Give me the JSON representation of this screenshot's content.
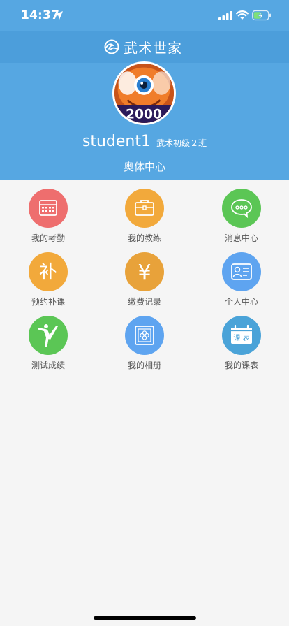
{
  "status_bar": {
    "time": "14:37"
  },
  "nav": {
    "title": "武术世家"
  },
  "profile": {
    "username": "student1",
    "class_name": "武术初级２班",
    "center_name": "奥体中心"
  },
  "menu": [
    {
      "label": "我的考勤",
      "icon": "attendance-calendar-icon",
      "color": "#ee6e6e"
    },
    {
      "label": "我的教练",
      "icon": "briefcase-icon",
      "color": "#f2a93b"
    },
    {
      "label": "消息中心",
      "icon": "chat-bubble-icon",
      "color": "#5bc655"
    },
    {
      "label": "预约补课",
      "icon": "makeup-class-icon",
      "color": "#f2a93b",
      "glyph": "补"
    },
    {
      "label": "缴费记录",
      "icon": "yen-icon",
      "color": "#e8a23a",
      "glyph": "¥"
    },
    {
      "label": "个人中心",
      "icon": "id-card-icon",
      "color": "#5ea4f0"
    },
    {
      "label": "测试成绩",
      "icon": "martial-kick-icon",
      "color": "#5bc655"
    },
    {
      "label": "我的相册",
      "icon": "photo-album-icon",
      "color": "#5ea4f0"
    },
    {
      "label": "我的课表",
      "icon": "schedule-icon",
      "color": "#4aa3d8",
      "glyph": "课 表"
    }
  ],
  "colors": {
    "header": "#56a7e2",
    "nav": "#4c9edb",
    "background": "#f5f5f5"
  }
}
